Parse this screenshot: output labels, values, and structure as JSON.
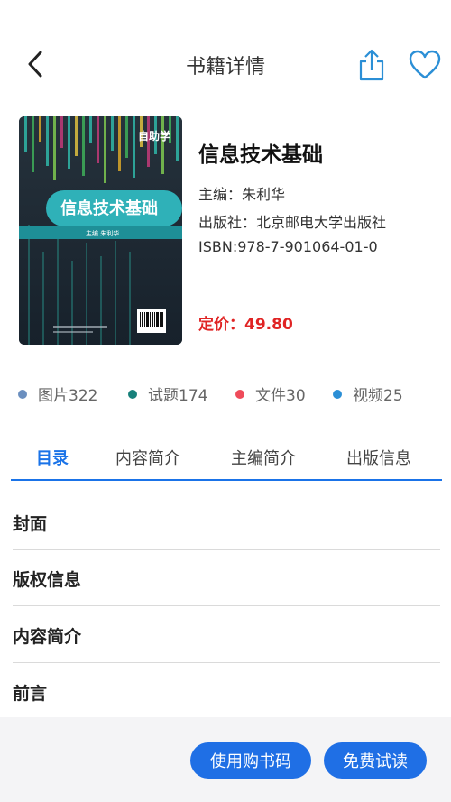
{
  "header": {
    "title": "书籍详情",
    "back_icon": "back-arrow-icon",
    "share_icon": "share-icon",
    "favorite_icon": "heart-icon"
  },
  "book": {
    "cover": {
      "series_label": "自助学",
      "title": "信息技术基础",
      "editor_line": "主编 朱利华"
    },
    "title": "信息技术基础",
    "editor": "主编：朱利华",
    "publisher": "出版社：北京邮电大学出版社",
    "isbn": "ISBN:978-7-901064-01-0",
    "price": "定价：49.80"
  },
  "stats": [
    {
      "label": "图片322",
      "color": "#6b8fbf"
    },
    {
      "label": "试题174",
      "color": "#17807a"
    },
    {
      "label": "文件30",
      "color": "#ef4b5a"
    },
    {
      "label": "视频25",
      "color": "#2b8fd6"
    }
  ],
  "tabs": [
    "目录",
    "内容简介",
    "主编简介",
    "出版信息"
  ],
  "active_tab": "目录",
  "toc": [
    "封面",
    "版权信息",
    "内容简介",
    "前言"
  ],
  "footer": {
    "redeem_label": "使用购书码",
    "trial_label": "免费试读"
  },
  "colors": {
    "accent": "#1a73e8",
    "button": "#1f6fe5",
    "price": "#e02424"
  }
}
